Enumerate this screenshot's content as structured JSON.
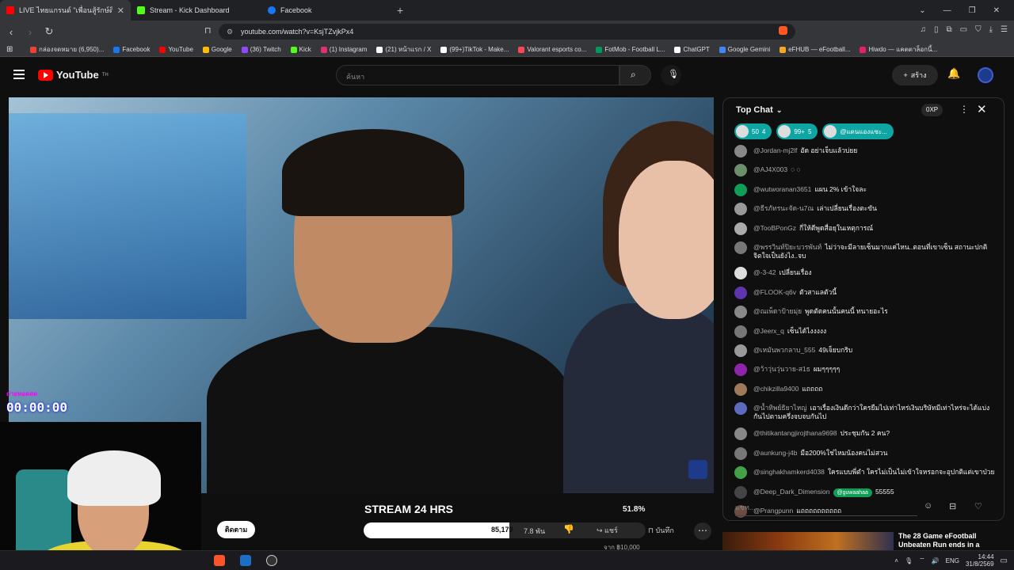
{
  "browser": {
    "tabs": [
      {
        "label": "LIVE ไทยแกรนด์ \"เพื่อนสู้รักษ์ดิน\"",
        "color": "#ff0000"
      },
      {
        "label": "Stream - Kick Dashboard",
        "color": "#53fc18"
      },
      {
        "label": "Facebook",
        "color": "#1877f2"
      }
    ],
    "new_tab": "+",
    "url": "youtube.com/watch?v=KsjTZvjkPx4",
    "bookmarks": [
      {
        "label": "กล่องจดหมาย (6,950)...",
        "color": "#ea4335"
      },
      {
        "label": "Facebook",
        "color": "#1877f2"
      },
      {
        "label": "YouTube",
        "color": "#ff0000"
      },
      {
        "label": "Google",
        "color": "#fbbc05"
      },
      {
        "label": "(36) Twitch",
        "color": "#9146ff"
      },
      {
        "label": "Kick",
        "color": "#53fc18"
      },
      {
        "label": "(1) Instagram",
        "color": "#e1306c"
      },
      {
        "label": "(21) หน้าแรก / X",
        "color": "#ffffff"
      },
      {
        "label": "(99+)TikTok - Make...",
        "color": "#ffffff"
      },
      {
        "label": "Valorant esports co...",
        "color": "#ff4655"
      },
      {
        "label": "FotMob - Football L...",
        "color": "#00985f"
      },
      {
        "label": "ChatGPT",
        "color": "#ffffff"
      },
      {
        "label": "Google Gemini",
        "color": "#4285f4"
      },
      {
        "label": "eFHUB — eFootball...",
        "color": "#f5a623"
      },
      {
        "label": "Hiwdo — แคตตาล็อกนี้...",
        "color": "#e91e63"
      }
    ]
  },
  "youtube": {
    "logo": "YouTube",
    "logo_sup": "TH",
    "search_placeholder": "ค้นหา",
    "create_label": "สร้าง"
  },
  "overlay": {
    "timer_label": "ถ่ายทอดสด",
    "timer": "00:00:00"
  },
  "below_video": {
    "title": "STREAM 24 HRS",
    "percent": "51.8%",
    "progress": 0.518,
    "follow_label": "ติดตาม",
    "like_count": "85,179",
    "like_count2": "7.8 พัน",
    "share_label": "แชร์",
    "save_label": "บันทึก",
    "goal": "จาก ฿10,000"
  },
  "chat": {
    "title": "Top Chat",
    "xp": "0XP",
    "pins": [
      {
        "a": "50",
        "b": "4"
      },
      {
        "a": "99+",
        "b": "5"
      },
      {
        "a": "@แดนแองแซะ..."
      }
    ],
    "messages": [
      {
        "author": "@Jordan-mj2lf",
        "text": "อัด อย่าเจ็บแล้วบ่ยย",
        "color": "#888888"
      },
      {
        "author": "@AJ4X003",
        "text": "◌ ◌",
        "color": "#6b8e6b"
      },
      {
        "author": "@wutworanan3651",
        "text": "แผน 2% เข้าใจละ",
        "color": "#0f9d58"
      },
      {
        "author": "@ธีรภัทรนะจัด-น7ณ",
        "text": "เล่าเปลี่ยนเรื่องตะขัน",
        "color": "#999999"
      },
      {
        "author": "@TooBPonGz",
        "text": "กี่ให้ดีพูดสื่อยุในเหตุการณ์",
        "color": "#aaaaaa"
      },
      {
        "author": "@พรรวินท์ปิยะบวรพันท์",
        "text": "ไม่ว่าจะมีลายเซ็นมากแค่ไหน..ตอนที่เขาเซ็น สถานะปกติจิตใจเป็นยังไง..จบ",
        "color": "#777777"
      },
      {
        "author": "@-3-42",
        "text": "เปลี่ยนเรื่อง",
        "color": "#dddddd"
      },
      {
        "author": "@FLOOK-q6v",
        "text": "ตัวสาแลตัวนี้",
        "color": "#5e35b1"
      },
      {
        "author": "@ณเพ็ดาป้ายมุ่ย",
        "text": "พูดตัดคนนั้นคนนี้ ทนายอะไร",
        "color": "#888888"
      },
      {
        "author": "@Jeerx_q",
        "text": "เซ็นได้ไงงงงง",
        "color": "#777777"
      },
      {
        "author": "@เหมันพวกลาบ_555",
        "text": "49เจ็ยบกริบ",
        "color": "#999999"
      },
      {
        "author": "@ว้าวุ่นวุ่นวาย-ส1ธ",
        "text": "ผมๆๆๆๆๆ",
        "color": "#8e24aa"
      },
      {
        "author": "@chikzilla9400",
        "text": "แถถถถ",
        "color": "#a0785a"
      },
      {
        "author": "@น้ำทิพย์ธิยาไหญ่",
        "text": "เอาเรื่องเงินดีกว่าใครยืมไปเท่าไหร่เงินบริษัทมีเท่าไหร่จะได้แบ่งกันไปตามครึ่งจบจบกันไป",
        "color": "#5c6bc0"
      },
      {
        "author": "@thitikantangjirojthana9698",
        "text": "ประชุมกัน 2 คน?",
        "color": "#888888"
      },
      {
        "author": "@aunkung-j4b",
        "text": "มือ200%ใช่ไหมน้องคนไม่สวน",
        "color": "#777777"
      },
      {
        "author": "@singhakhamkerd4038",
        "text": "ใครแบบพี่ตำ ใครไม่เป็นไม่เข้าใจหรอกจะอุปกติแต่เขาป่วย",
        "color": "#43a047"
      },
      {
        "author": "@Deep_Dark_Dimension",
        "badge": "@guwaahaa",
        "text": "55555",
        "color": "#444444"
      },
      {
        "author": "@Prangpunn",
        "text": "แถถถถถถถถถถ",
        "color": "#6d4c41"
      }
    ],
    "input_placeholder": "แชท..."
  },
  "recommendation": {
    "title": "The 28 Game eFootball Unbeaten Run ends in a"
  },
  "taskbar": {
    "lang": "ENG",
    "time": "14:44",
    "date": "31/8/2569"
  }
}
